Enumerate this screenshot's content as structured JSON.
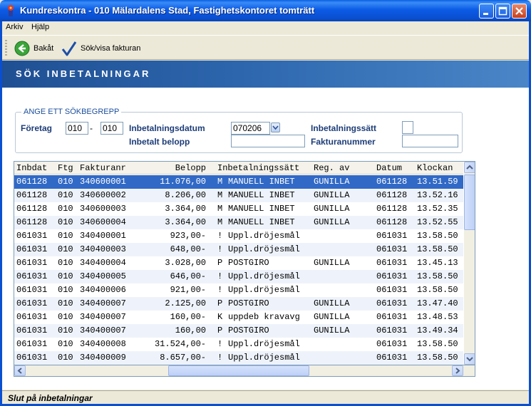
{
  "window": {
    "title": "Kundreskontra  -  010 Mälardalens Stad, Fastighetskontoret tomträtt"
  },
  "menu": {
    "items": [
      {
        "label": "Arkiv"
      },
      {
        "label": "Hjälp"
      }
    ]
  },
  "toolbar": {
    "back_label": "Bakåt",
    "search_label": "Sök/visa fakturan"
  },
  "header": {
    "title": "SÖK INBETALNINGAR"
  },
  "search": {
    "legend": "ANGE ETT SÖKBEGREPP",
    "foretag_label": "Företag",
    "foretag_from": "010",
    "foretag_to": "010",
    "inbetalningsdatum_label": "Inbetalningsdatum",
    "inbetalningsdatum_value": "070206",
    "inbetalningssatt_label": "Inbetalningssätt",
    "inbetalningssatt_value": "",
    "inbetalt_belopp_label": "Inbetalt belopp",
    "inbetalt_belopp_value": "",
    "fakturanummer_label": "Fakturanummer",
    "fakturanummer_value": ""
  },
  "grid": {
    "columns": [
      "Inbdat",
      "Ftg",
      "Fakturanr",
      "Belopp",
      "Inbetalningssätt",
      "Reg. av",
      "Datum",
      "Klockan"
    ],
    "rows": [
      {
        "inbdat": "061128",
        "ftg": "010",
        "faktura": "340600001",
        "belopp": "11.076,00",
        "kod": "M",
        "satt": "MANUELL INBET",
        "reg": "GUNILLA",
        "datum": "061128",
        "klockan": "13.51.59"
      },
      {
        "inbdat": "061128",
        "ftg": "010",
        "faktura": "340600002",
        "belopp": "8.206,00",
        "kod": "M",
        "satt": "MANUELL INBET",
        "reg": "GUNILLA",
        "datum": "061128",
        "klockan": "13.52.16"
      },
      {
        "inbdat": "061128",
        "ftg": "010",
        "faktura": "340600003",
        "belopp": "3.364,00",
        "kod": "M",
        "satt": "MANUELL INBET",
        "reg": "GUNILLA",
        "datum": "061128",
        "klockan": "13.52.35"
      },
      {
        "inbdat": "061128",
        "ftg": "010",
        "faktura": "340600004",
        "belopp": "3.364,00",
        "kod": "M",
        "satt": "MANUELL INBET",
        "reg": "GUNILLA",
        "datum": "061128",
        "klockan": "13.52.55"
      },
      {
        "inbdat": "061031",
        "ftg": "010",
        "faktura": "340400001",
        "belopp": "923,00-",
        "kod": "!",
        "satt": "Uppl.dröjesmål",
        "reg": "",
        "datum": "061031",
        "klockan": "13.58.50"
      },
      {
        "inbdat": "061031",
        "ftg": "010",
        "faktura": "340400003",
        "belopp": "648,00-",
        "kod": "!",
        "satt": "Uppl.dröjesmål",
        "reg": "",
        "datum": "061031",
        "klockan": "13.58.50"
      },
      {
        "inbdat": "061031",
        "ftg": "010",
        "faktura": "340400004",
        "belopp": "3.028,00",
        "kod": "P",
        "satt": "POSTGIRO",
        "reg": "GUNILLA",
        "datum": "061031",
        "klockan": "13.45.13"
      },
      {
        "inbdat": "061031",
        "ftg": "010",
        "faktura": "340400005",
        "belopp": "646,00-",
        "kod": "!",
        "satt": "Uppl.dröjesmål",
        "reg": "",
        "datum": "061031",
        "klockan": "13.58.50"
      },
      {
        "inbdat": "061031",
        "ftg": "010",
        "faktura": "340400006",
        "belopp": "921,00-",
        "kod": "!",
        "satt": "Uppl.dröjesmål",
        "reg": "",
        "datum": "061031",
        "klockan": "13.58.50"
      },
      {
        "inbdat": "061031",
        "ftg": "010",
        "faktura": "340400007",
        "belopp": "2.125,00",
        "kod": "P",
        "satt": "POSTGIRO",
        "reg": "GUNILLA",
        "datum": "061031",
        "klockan": "13.47.40"
      },
      {
        "inbdat": "061031",
        "ftg": "010",
        "faktura": "340400007",
        "belopp": "160,00-",
        "kod": "K",
        "satt": "uppdeb kravavg",
        "reg": "GUNILLA",
        "datum": "061031",
        "klockan": "13.48.53"
      },
      {
        "inbdat": "061031",
        "ftg": "010",
        "faktura": "340400007",
        "belopp": "160,00",
        "kod": "P",
        "satt": "POSTGIRO",
        "reg": "GUNILLA",
        "datum": "061031",
        "klockan": "13.49.34"
      },
      {
        "inbdat": "061031",
        "ftg": "010",
        "faktura": "340400008",
        "belopp": "31.524,00-",
        "kod": "!",
        "satt": "Uppl.dröjesmål",
        "reg": "",
        "datum": "061031",
        "klockan": "13.58.50"
      },
      {
        "inbdat": "061031",
        "ftg": "010",
        "faktura": "340400009",
        "belopp": "8.657,00-",
        "kod": "!",
        "satt": "Uppl.dröjesmål",
        "reg": "",
        "datum": "061031",
        "klockan": "13.58.50"
      }
    ]
  },
  "status": {
    "text": "Slut på inbetalningar"
  }
}
